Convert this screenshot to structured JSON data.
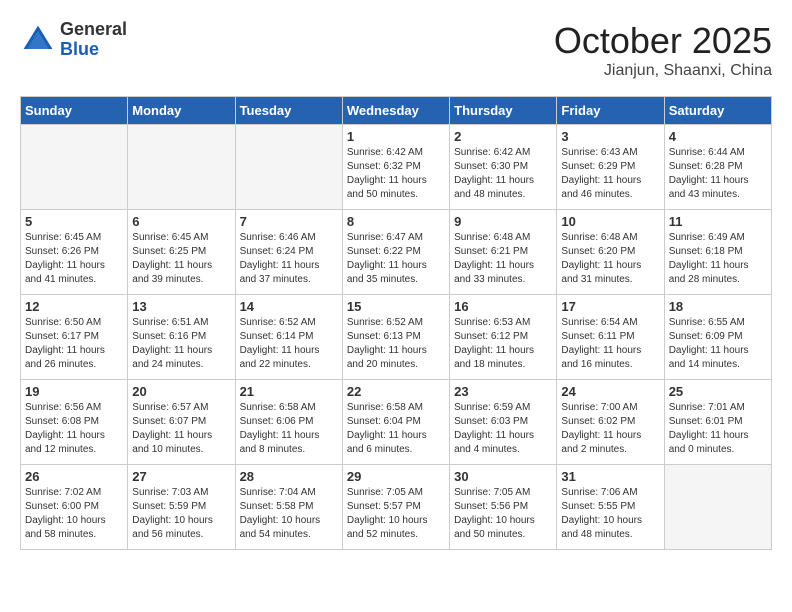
{
  "header": {
    "logo_general": "General",
    "logo_blue": "Blue",
    "month": "October 2025",
    "location": "Jianjun, Shaanxi, China"
  },
  "weekdays": [
    "Sunday",
    "Monday",
    "Tuesday",
    "Wednesday",
    "Thursday",
    "Friday",
    "Saturday"
  ],
  "weeks": [
    [
      {
        "day": "",
        "info": ""
      },
      {
        "day": "",
        "info": ""
      },
      {
        "day": "",
        "info": ""
      },
      {
        "day": "1",
        "info": "Sunrise: 6:42 AM\nSunset: 6:32 PM\nDaylight: 11 hours\nand 50 minutes."
      },
      {
        "day": "2",
        "info": "Sunrise: 6:42 AM\nSunset: 6:30 PM\nDaylight: 11 hours\nand 48 minutes."
      },
      {
        "day": "3",
        "info": "Sunrise: 6:43 AM\nSunset: 6:29 PM\nDaylight: 11 hours\nand 46 minutes."
      },
      {
        "day": "4",
        "info": "Sunrise: 6:44 AM\nSunset: 6:28 PM\nDaylight: 11 hours\nand 43 minutes."
      }
    ],
    [
      {
        "day": "5",
        "info": "Sunrise: 6:45 AM\nSunset: 6:26 PM\nDaylight: 11 hours\nand 41 minutes."
      },
      {
        "day": "6",
        "info": "Sunrise: 6:45 AM\nSunset: 6:25 PM\nDaylight: 11 hours\nand 39 minutes."
      },
      {
        "day": "7",
        "info": "Sunrise: 6:46 AM\nSunset: 6:24 PM\nDaylight: 11 hours\nand 37 minutes."
      },
      {
        "day": "8",
        "info": "Sunrise: 6:47 AM\nSunset: 6:22 PM\nDaylight: 11 hours\nand 35 minutes."
      },
      {
        "day": "9",
        "info": "Sunrise: 6:48 AM\nSunset: 6:21 PM\nDaylight: 11 hours\nand 33 minutes."
      },
      {
        "day": "10",
        "info": "Sunrise: 6:48 AM\nSunset: 6:20 PM\nDaylight: 11 hours\nand 31 minutes."
      },
      {
        "day": "11",
        "info": "Sunrise: 6:49 AM\nSunset: 6:18 PM\nDaylight: 11 hours\nand 28 minutes."
      }
    ],
    [
      {
        "day": "12",
        "info": "Sunrise: 6:50 AM\nSunset: 6:17 PM\nDaylight: 11 hours\nand 26 minutes."
      },
      {
        "day": "13",
        "info": "Sunrise: 6:51 AM\nSunset: 6:16 PM\nDaylight: 11 hours\nand 24 minutes."
      },
      {
        "day": "14",
        "info": "Sunrise: 6:52 AM\nSunset: 6:14 PM\nDaylight: 11 hours\nand 22 minutes."
      },
      {
        "day": "15",
        "info": "Sunrise: 6:52 AM\nSunset: 6:13 PM\nDaylight: 11 hours\nand 20 minutes."
      },
      {
        "day": "16",
        "info": "Sunrise: 6:53 AM\nSunset: 6:12 PM\nDaylight: 11 hours\nand 18 minutes."
      },
      {
        "day": "17",
        "info": "Sunrise: 6:54 AM\nSunset: 6:11 PM\nDaylight: 11 hours\nand 16 minutes."
      },
      {
        "day": "18",
        "info": "Sunrise: 6:55 AM\nSunset: 6:09 PM\nDaylight: 11 hours\nand 14 minutes."
      }
    ],
    [
      {
        "day": "19",
        "info": "Sunrise: 6:56 AM\nSunset: 6:08 PM\nDaylight: 11 hours\nand 12 minutes."
      },
      {
        "day": "20",
        "info": "Sunrise: 6:57 AM\nSunset: 6:07 PM\nDaylight: 11 hours\nand 10 minutes."
      },
      {
        "day": "21",
        "info": "Sunrise: 6:58 AM\nSunset: 6:06 PM\nDaylight: 11 hours\nand 8 minutes."
      },
      {
        "day": "22",
        "info": "Sunrise: 6:58 AM\nSunset: 6:04 PM\nDaylight: 11 hours\nand 6 minutes."
      },
      {
        "day": "23",
        "info": "Sunrise: 6:59 AM\nSunset: 6:03 PM\nDaylight: 11 hours\nand 4 minutes."
      },
      {
        "day": "24",
        "info": "Sunrise: 7:00 AM\nSunset: 6:02 PM\nDaylight: 11 hours\nand 2 minutes."
      },
      {
        "day": "25",
        "info": "Sunrise: 7:01 AM\nSunset: 6:01 PM\nDaylight: 11 hours\nand 0 minutes."
      }
    ],
    [
      {
        "day": "26",
        "info": "Sunrise: 7:02 AM\nSunset: 6:00 PM\nDaylight: 10 hours\nand 58 minutes."
      },
      {
        "day": "27",
        "info": "Sunrise: 7:03 AM\nSunset: 5:59 PM\nDaylight: 10 hours\nand 56 minutes."
      },
      {
        "day": "28",
        "info": "Sunrise: 7:04 AM\nSunset: 5:58 PM\nDaylight: 10 hours\nand 54 minutes."
      },
      {
        "day": "29",
        "info": "Sunrise: 7:05 AM\nSunset: 5:57 PM\nDaylight: 10 hours\nand 52 minutes."
      },
      {
        "day": "30",
        "info": "Sunrise: 7:05 AM\nSunset: 5:56 PM\nDaylight: 10 hours\nand 50 minutes."
      },
      {
        "day": "31",
        "info": "Sunrise: 7:06 AM\nSunset: 5:55 PM\nDaylight: 10 hours\nand 48 minutes."
      },
      {
        "day": "",
        "info": ""
      }
    ]
  ]
}
